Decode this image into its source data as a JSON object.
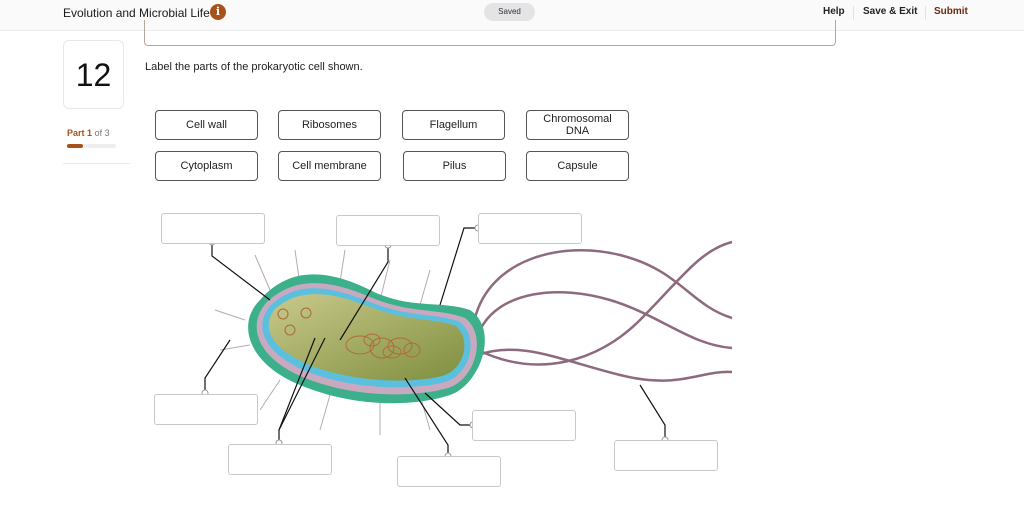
{
  "header": {
    "app_title": "Evolution and Microbial Life",
    "info_icon": "info-icon",
    "saved_status": "Saved",
    "help_label": "Help",
    "save_exit_label": "Save & Exit",
    "submit_label": "Submit"
  },
  "question": {
    "number": "12",
    "part_label": "Part",
    "part_current": "1",
    "part_of": "of 3",
    "progress_fraction": 0.33,
    "prompt": "Label the parts of the prokaryotic cell shown."
  },
  "label_bank": [
    {
      "label": "Cell wall"
    },
    {
      "label": "Ribosomes"
    },
    {
      "label": "Flagellum"
    },
    {
      "label": "Chromosomal DNA"
    },
    {
      "label": "Cytoplasm"
    },
    {
      "label": "Cell membrane"
    },
    {
      "label": "Pilus"
    },
    {
      "label": "Capsule"
    }
  ],
  "drop_targets_count": 8,
  "colors": {
    "accent": "#a6521c",
    "submit": "#6b2b12",
    "capsule": "#3bb08a",
    "cytoplasm": "#a8b070",
    "membrane": "#5bc0de",
    "flagella": "#8e6a7e"
  }
}
